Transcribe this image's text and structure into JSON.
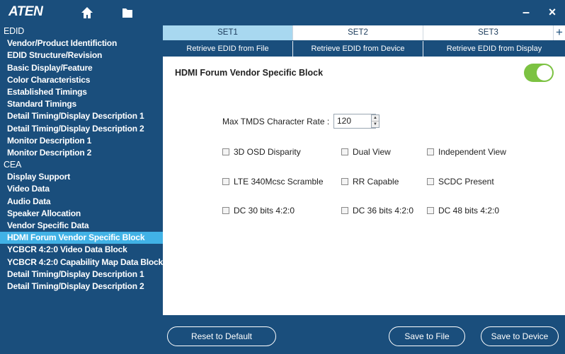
{
  "app": {
    "logo": "ATEN",
    "minimize": "–",
    "close": "×"
  },
  "sidebar": {
    "items": [
      {
        "label": "EDID",
        "type": "cat"
      },
      {
        "label": "Vendor/Product Identifiction",
        "type": "sub"
      },
      {
        "label": "EDID Structure/Revision",
        "type": "sub"
      },
      {
        "label": "Basic Display/Feature",
        "type": "sub"
      },
      {
        "label": "Color Characteristics",
        "type": "sub"
      },
      {
        "label": "Established Timings",
        "type": "sub"
      },
      {
        "label": "Standard Timings",
        "type": "sub"
      },
      {
        "label": "Detail Timing/Display Description 1",
        "type": "sub"
      },
      {
        "label": "Detail Timing/Display Description 2",
        "type": "sub"
      },
      {
        "label": "Monitor Description 1",
        "type": "sub"
      },
      {
        "label": "Monitor Description 2",
        "type": "sub"
      },
      {
        "label": "CEA",
        "type": "cat"
      },
      {
        "label": "Display Support",
        "type": "sub"
      },
      {
        "label": "Video Data",
        "type": "sub"
      },
      {
        "label": "Audio Data",
        "type": "sub"
      },
      {
        "label": "Speaker Allocation",
        "type": "sub"
      },
      {
        "label": "Vendor Specific Data",
        "type": "sub"
      },
      {
        "label": "HDMI Forum Vendor Specific Block",
        "type": "sub",
        "selected": true
      },
      {
        "label": "YCBCR 4:2:0 Video Data Block",
        "type": "sub"
      },
      {
        "label": "YCBCR 4:2:0 Capability Map Data Block",
        "type": "sub"
      },
      {
        "label": "Detail Timing/Display Description 1",
        "type": "sub"
      },
      {
        "label": "Detail Timing/Display Description 2",
        "type": "sub"
      }
    ]
  },
  "tabs": [
    {
      "label": "SET1",
      "active": true
    },
    {
      "label": "SET2",
      "active": false
    },
    {
      "label": "SET3",
      "active": false
    }
  ],
  "tab_add": "+",
  "actions": [
    {
      "label": "Retrieve EDID from File"
    },
    {
      "label": "Retrieve EDID from Device"
    },
    {
      "label": "Retrieve EDID from Display"
    }
  ],
  "main": {
    "section_title": "HDMI Forum Vendor Specific Block",
    "toggle_on": true,
    "tmds_label": "Max TMDS Character Rate :",
    "tmds_value": "120",
    "checkboxes": [
      {
        "label": "3D OSD Disparity",
        "checked": false
      },
      {
        "label": "Dual View",
        "checked": false
      },
      {
        "label": "Independent View",
        "checked": false
      },
      {
        "label": "LTE 340Mcsc Scramble",
        "checked": false
      },
      {
        "label": "RR Capable",
        "checked": false
      },
      {
        "label": "SCDC Present",
        "checked": false
      },
      {
        "label": "DC 30 bits 4:2:0",
        "checked": false
      },
      {
        "label": "DC 36 bits 4:2:0",
        "checked": false
      },
      {
        "label": "DC 48 bits 4:2:0",
        "checked": false
      }
    ]
  },
  "footer": {
    "reset": "Reset to Default",
    "save_file": "Save to File",
    "save_device": "Save to Device"
  },
  "colors": {
    "primary": "#1a4e7c",
    "selected": "#41b2e6",
    "tab_active": "#a8d8f0",
    "toggle_on": "#7cc242"
  }
}
